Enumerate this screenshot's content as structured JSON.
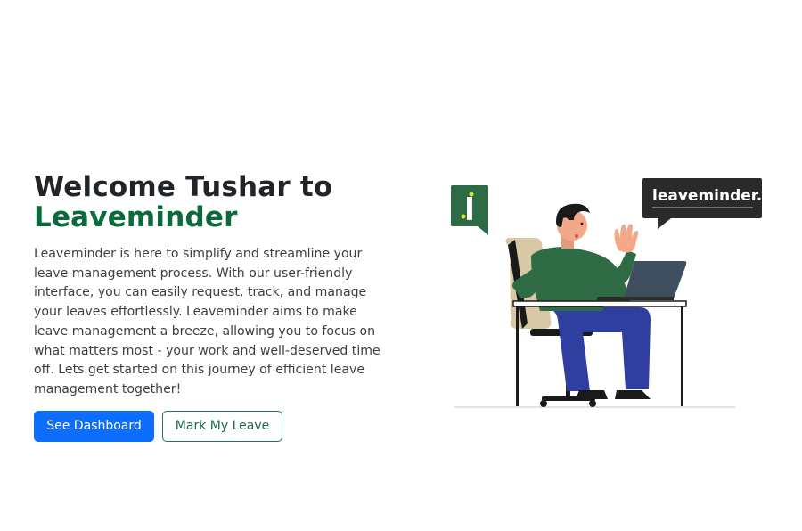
{
  "hero": {
    "title_line1": "Welcome Tushar to",
    "title_brand": "Leaveminder",
    "description": "Leaveminder is here to simplify and streamline your leave management process. With our user-friendly interface, you can easily request, track, and manage your leaves effortlessly. Leaveminder aims to make leave management a breeze, allowing you to focus on what matters most - your work and well-deserved time off. Lets get started on this journey of efficient leave management together!",
    "primary_button": "See Dashboard",
    "secondary_button": "Mark My Leave"
  },
  "illustration": {
    "logo_text": "leaveminder.",
    "colors": {
      "brand_green": "#2d6a45",
      "bubble_dark": "#2a2a2a",
      "accent_lime": "#c6e63a",
      "shirt": "#2f6b45",
      "pants": "#2e3fa0",
      "laptop": "#3f4f5f"
    }
  },
  "colors": {
    "primary": "#0d6efd",
    "brand_text": "#0a6a3a",
    "heading": "#212529"
  }
}
